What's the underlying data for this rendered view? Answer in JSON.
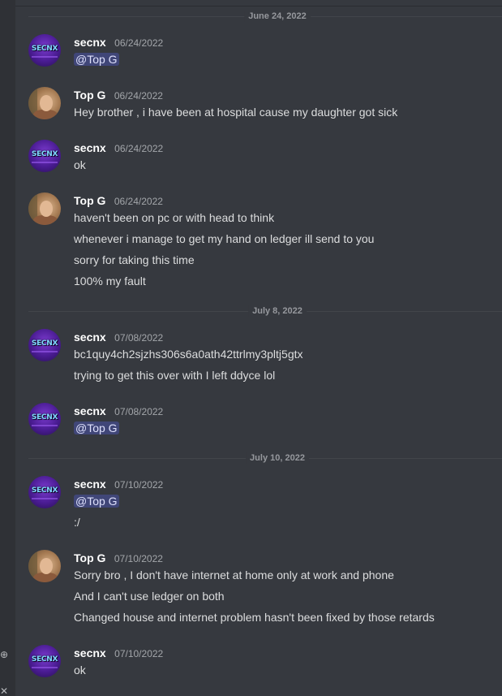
{
  "sidebar": {
    "icons": [
      "gift-icon",
      "close-icon"
    ],
    "glyphs": [
      "⊕",
      "✕"
    ]
  },
  "dividers": [
    {
      "date": "June 24, 2022"
    },
    {
      "date": "July 8, 2022"
    },
    {
      "date": "July 10, 2022"
    }
  ],
  "messages": [
    {
      "author": "secnx",
      "time": "06/24/2022",
      "lines": [
        "@Top G"
      ],
      "avatar": "secnx-avatar"
    },
    {
      "author": "Top G",
      "time": "06/24/2022",
      "lines": [
        "Hey brother , i have been at hospital cause my daughter got sick"
      ],
      "avatar": "topg-avatar"
    },
    {
      "author": "secnx",
      "time": "06/24/2022",
      "lines": [
        "ok"
      ],
      "avatar": "secnx-avatar"
    },
    {
      "author": "Top G",
      "time": "06/24/2022",
      "lines": [
        "haven't been on pc or with head to think",
        "whenever i manage to get my hand on ledger ill send to you",
        "sorry for taking this time",
        "100% my fault"
      ],
      "avatar": "topg-avatar"
    },
    {
      "author": "secnx",
      "time": "07/08/2022",
      "lines": [
        "bc1quy4ch2sjzhs306s6a0ath42ttrlmy3pltj5gtx",
        "trying to get this over with I left ddyce lol"
      ],
      "avatar": "secnx-avatar"
    },
    {
      "author": "secnx",
      "time": "07/08/2022",
      "lines": [
        "@Top G"
      ],
      "avatar": "secnx-avatar"
    },
    {
      "author": "secnx",
      "time": "07/10/2022",
      "lines": [
        "@Top G",
        ":/"
      ],
      "avatar": "secnx-avatar"
    },
    {
      "author": "Top G",
      "time": "07/10/2022",
      "lines": [
        "Sorry bro , I don't have internet at home only at work and phone",
        "And I can't use ledger on both",
        "Changed house and internet problem hasn't been fixed by those retards"
      ],
      "avatar": "topg-avatar"
    },
    {
      "author": "secnx",
      "time": "07/10/2022",
      "lines": [
        "ok"
      ],
      "avatar": "secnx-avatar"
    }
  ],
  "avatar_text": {
    "secnx": "SECNX"
  },
  "colors": {
    "background": "#36393f",
    "sidebar": "#2f3136",
    "mention_bg": "#414675",
    "text": "#dcddde",
    "timestamp": "#a3a6aa"
  }
}
